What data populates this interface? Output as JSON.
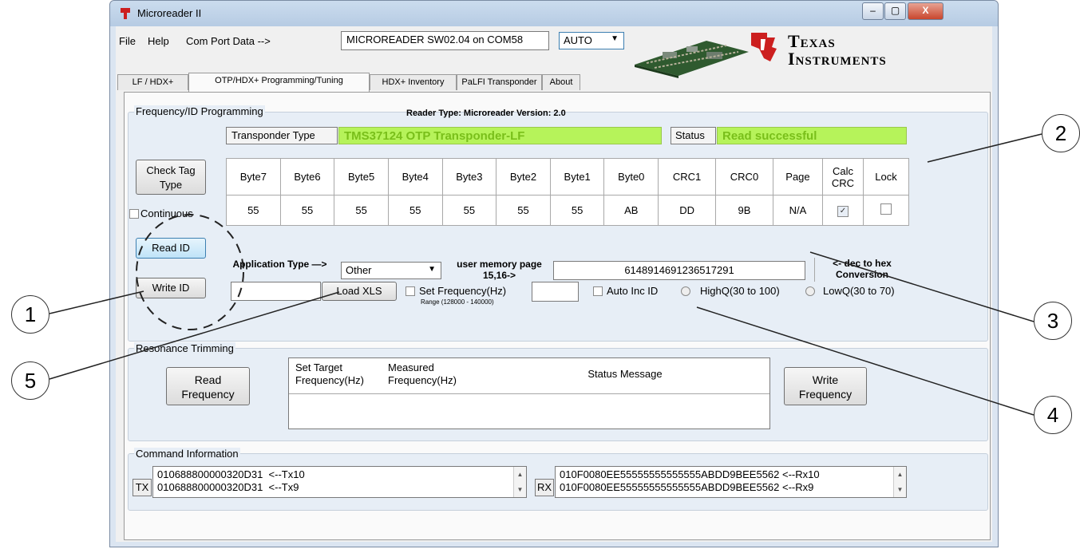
{
  "window": {
    "title": "Microreader II",
    "controls": {
      "minimize": "–",
      "maximize": "▢",
      "close": "X"
    }
  },
  "menu": {
    "file": "File",
    "help": "Help",
    "com_port_label": "Com Port Data -->",
    "com_port_value": "MICROREADER SW02.04 on COM58",
    "mode_select": "AUTO"
  },
  "logo": {
    "line1": "Texas",
    "line2": "Instruments"
  },
  "tabs": [
    {
      "label": "LF / HDX+"
    },
    {
      "label": "OTP/HDX+ Programming/Tuning"
    },
    {
      "label": "HDX+ Inventory"
    },
    {
      "label": "PaLFI Transponder"
    },
    {
      "label": "About"
    }
  ],
  "freq_group": {
    "title": "Frequency/ID Programming",
    "reader_info": "Reader Type: Microreader   Version: 2.0",
    "transponder_type_label": "Transponder Type",
    "transponder_type_value": "TMS37124 OTP Transponder-LF",
    "status_label": "Status",
    "status_value": "Read successful",
    "check_tag_button": "Check Tag Type",
    "continuous_label": "Continuous",
    "read_id_button": "Read ID",
    "write_id_button": "Write ID",
    "table": {
      "headers": [
        "Byte7",
        "Byte6",
        "Byte5",
        "Byte4",
        "Byte3",
        "Byte2",
        "Byte1",
        "Byte0",
        "CRC1",
        "CRC0",
        "Page",
        "Calc CRC",
        "Lock"
      ],
      "values": [
        "55",
        "55",
        "55",
        "55",
        "55",
        "55",
        "55",
        "AB",
        "DD",
        "9B",
        "N/A"
      ],
      "calc_crc_checked": true,
      "lock_checked": false
    },
    "app_type_label": "Application Type  —>",
    "app_type_select": "Other",
    "user_memory_label": "user memory page 15,16->",
    "decimal_value": "6148914691236517291",
    "conversion_label": "<- dec to hex Conversion",
    "load_xls_button": "Load XLS",
    "set_frequency_label": "Set Frequency(Hz)",
    "range_label": "Range (128000 - 140000)",
    "auto_inc_label": "Auto Inc ID",
    "highq_label": "HighQ(30 to 100)",
    "lowq_label": "LowQ(30 to 70)"
  },
  "resonance_group": {
    "title": "Resonance Trimming",
    "read_frequency_button": "Read Frequency",
    "write_frequency_button": "Write Frequency",
    "headers": [
      "Set Target Frequency(Hz)",
      "Measured Frequency(Hz)",
      "Status Message"
    ]
  },
  "command_group": {
    "title": "Command Information",
    "tx_label": "TX",
    "tx_lines": [
      "010688800000320D31  <--Tx10",
      "010688800000320D31  <--Tx9"
    ],
    "rx_label": "RX",
    "rx_lines": [
      "010F0080EE55555555555555ABDD9BEE5562 <--Rx10",
      "010F0080EE55555555555555ABDD9BEE5562 <--Rx9"
    ]
  },
  "callouts": [
    "1",
    "2",
    "3",
    "4",
    "5"
  ]
}
